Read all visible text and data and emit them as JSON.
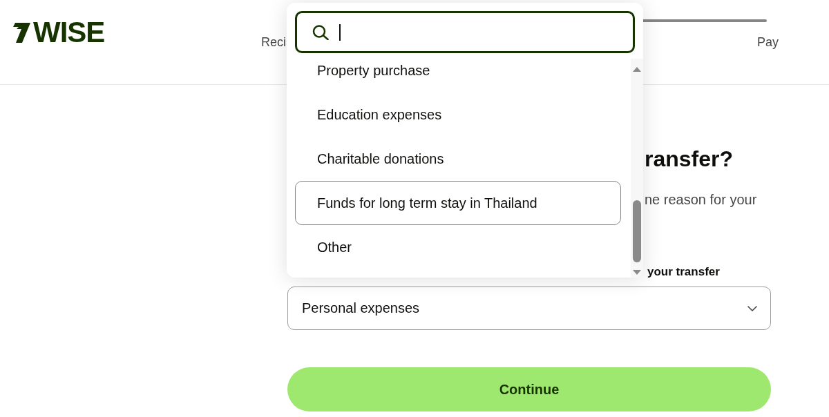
{
  "header": {
    "logo": "WISE",
    "stepper": {
      "steps": [
        {
          "label": "Reci"
        },
        {
          "label": "Pay"
        }
      ]
    }
  },
  "form": {
    "heading": "ransfer?",
    "subtitle": "ne reason for your",
    "field_label": "your transfer",
    "select": {
      "value": "Personal expenses"
    },
    "continue_button": "Continue"
  },
  "dropdown": {
    "search": {
      "focused": true
    },
    "options": [
      {
        "label": "Property purchase",
        "selected": false
      },
      {
        "label": "Education expenses",
        "selected": false
      },
      {
        "label": "Charitable donations",
        "selected": false
      },
      {
        "label": "Funds for long term stay in Thailand",
        "selected": true
      },
      {
        "label": "Other",
        "selected": false
      }
    ]
  }
}
